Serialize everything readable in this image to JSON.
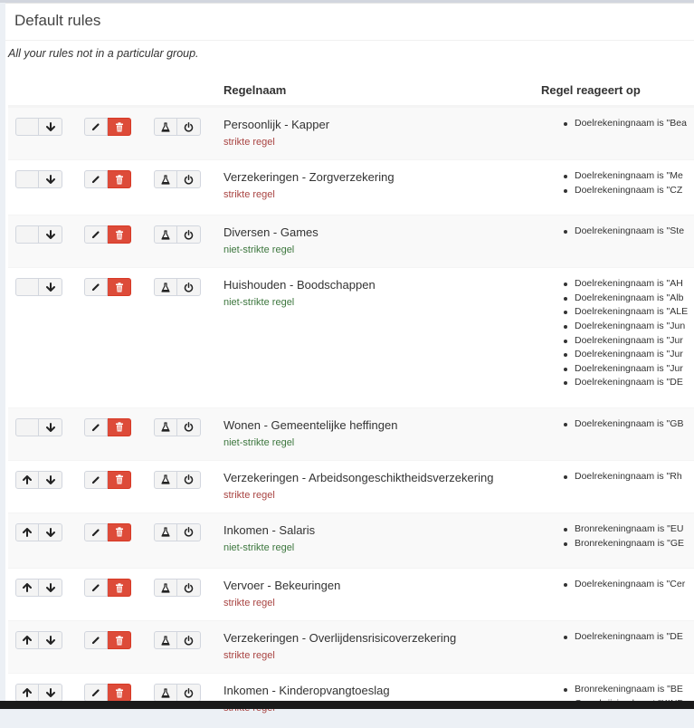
{
  "box": {
    "title": "Default rules",
    "subtitle": "All your rules not in a particular group."
  },
  "table": {
    "col_name": "Regelnaam",
    "col_triggers": "Regel reageert op"
  },
  "rows": [
    {
      "title": "Persoonlijk - Kapper",
      "strict": "strikte regel",
      "up": false,
      "triggers": [
        "Doelrekeningnaam is \"Bea"
      ]
    },
    {
      "title": "Verzekeringen - Zorgverzekering",
      "strict": "strikte regel",
      "up": false,
      "triggers": [
        "Doelrekeningnaam is \"Me",
        "Doelrekeningnaam is \"CZ"
      ]
    },
    {
      "title": "Diversen - Games",
      "strict": "niet-strikte regel",
      "up": false,
      "triggers": [
        "Doelrekeningnaam is \"Ste"
      ]
    },
    {
      "title": "Huishouden - Boodschappen",
      "strict": "niet-strikte regel",
      "up": false,
      "triggers": [
        "Doelrekeningnaam is \"AH",
        "Doelrekeningnaam is \"Alb",
        "Doelrekeningnaam is \"ALE",
        "Doelrekeningnaam is \"Jun",
        "Doelrekeningnaam is \"Jur",
        "Doelrekeningnaam is \"Jur",
        "Doelrekeningnaam is \"Jur",
        "Doelrekeningnaam is \"DE"
      ]
    },
    {
      "title": "Wonen - Gemeentelijke heffingen",
      "strict": "niet-strikte regel",
      "up": false,
      "triggers": [
        "Doelrekeningnaam is \"GB"
      ]
    },
    {
      "title": "Verzekeringen - Arbeidsongeschiktheidsverzekering",
      "strict": "strikte regel",
      "up": true,
      "triggers": [
        "Doelrekeningnaam is \"Rh"
      ]
    },
    {
      "title": "Inkomen - Salaris",
      "strict": "niet-strikte regel",
      "up": true,
      "triggers": [
        "Bronrekeningnaam is \"EU",
        "Bronrekeningnaam is \"GE"
      ]
    },
    {
      "title": "Vervoer - Bekeuringen",
      "strict": "strikte regel",
      "up": true,
      "triggers": [
        "Doelrekeningnaam is \"Cer"
      ]
    },
    {
      "title": "Verzekeringen - Overlijdensrisicoverzekering",
      "strict": "strikte regel",
      "up": true,
      "triggers": [
        "Doelrekeningnaam is \"DE"
      ]
    },
    {
      "title": "Inkomen - Kinderopvangtoeslag",
      "strict": "strikte regel",
      "up": true,
      "triggers": [
        "Bronrekeningnaam is \"BE",
        "Omschrijving bevat \"KIND"
      ]
    }
  ],
  "icons": {
    "move_up": "arrow-up-icon",
    "move_down": "arrow-down-icon",
    "edit": "pencil-icon",
    "delete": "trash-icon",
    "test": "flask-icon",
    "toggle": "power-icon"
  },
  "colors": {
    "danger": "#dd4b39",
    "strict": "#a94442",
    "non_strict": "#3c763d",
    "row_stripe": "#f9f9f9"
  }
}
